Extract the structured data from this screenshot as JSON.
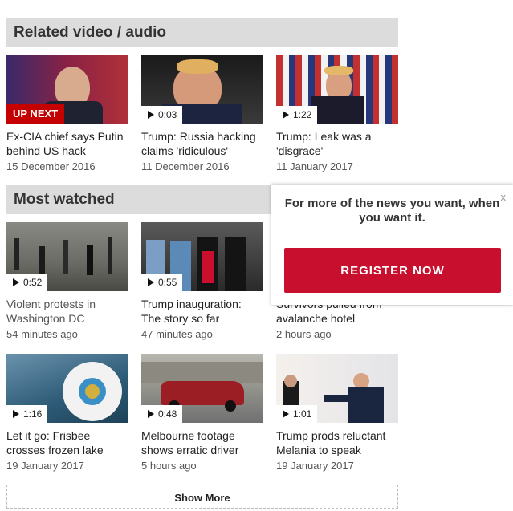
{
  "related": {
    "heading": "Related video / audio",
    "items": [
      {
        "badge": "UP NEXT",
        "title": "Ex-CIA chief says Putin behind US hack",
        "date": "15 December 2016"
      },
      {
        "duration": "0:03",
        "title": "Trump: Russia hacking claims 'ridiculous'",
        "date": "11 December 2016"
      },
      {
        "duration": "1:22",
        "title": "Trump: Leak was a 'disgrace'",
        "date": "11 January 2017"
      }
    ]
  },
  "most_watched": {
    "heading": "Most watched",
    "items": [
      {
        "duration": "0:52",
        "title": "Violent protests in Washington DC",
        "date": "54 minutes ago"
      },
      {
        "duration": "0:55",
        "title": "Trump inauguration: The story so far",
        "date": "47 minutes ago"
      },
      {
        "title": "Survivors pulled from avalanche hotel",
        "date": "2 hours ago"
      },
      {
        "duration": "1:16",
        "title": "Let it go: Frisbee crosses frozen lake",
        "date": "19 January 2017"
      },
      {
        "duration": "0:48",
        "title": "Melbourne footage shows erratic driver",
        "date": "5 hours ago"
      },
      {
        "duration": "1:01",
        "title": "Trump prods reluctant Melania to speak",
        "date": "19 January 2017"
      }
    ]
  },
  "popup": {
    "message": "For more of the news you want, when you want it.",
    "button": "REGISTER NOW",
    "close": "x"
  },
  "show_more": "Show More",
  "colors": {
    "accent": "#c8102e",
    "up_next": "#c40000",
    "header_bg": "#dcdcdc"
  }
}
